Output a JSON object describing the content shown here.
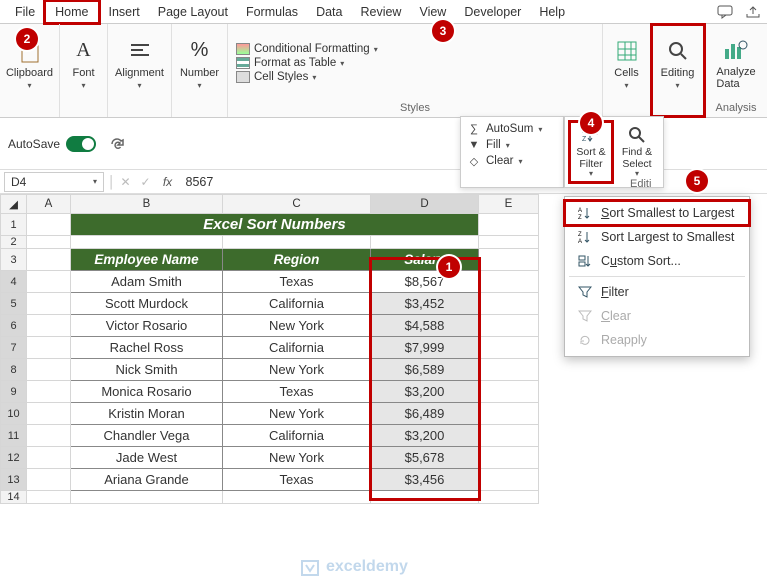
{
  "tabs": {
    "file": "File",
    "home": "Home",
    "insert": "Insert",
    "pagelayout": "Page Layout",
    "formulas": "Formulas",
    "data": "Data",
    "review": "Review",
    "view": "View",
    "developer": "Developer",
    "help": "Help"
  },
  "ribbon": {
    "clipboard": "Clipboard",
    "font": "Font",
    "alignment": "Alignment",
    "number": "Number",
    "styles_label": "Styles",
    "cond_fmt": "Conditional Formatting",
    "fmt_table": "Format as Table",
    "cell_styles": "Cell Styles",
    "cells": "Cells",
    "editing": "Editing",
    "analysis": "Analysis",
    "analyze_data": "Analyze\nData"
  },
  "substrip": {
    "autosave": "AutoSave",
    "autosum": "AutoSum",
    "fill": "Fill",
    "clear": "Clear",
    "sort_filter": "Sort &\nFilter",
    "find_select": "Find &\nSelect",
    "editing_label": "Editi"
  },
  "fbar": {
    "namebox": "D4",
    "formula": "8567"
  },
  "cols": {
    "a": "A",
    "b": "B",
    "c": "C",
    "d": "D",
    "e": "E"
  },
  "rows": [
    "1",
    "2",
    "3",
    "4",
    "5",
    "6",
    "7",
    "8",
    "9",
    "10",
    "11",
    "12",
    "13",
    "14"
  ],
  "title": "Excel Sort Numbers",
  "headers": {
    "emp": "Employee Name",
    "region": "Region",
    "salary": "Salary"
  },
  "data": [
    {
      "emp": "Adam Smith",
      "region": "Texas",
      "salary": "$8,567"
    },
    {
      "emp": "Scott Murdock",
      "region": "California",
      "salary": "$3,452"
    },
    {
      "emp": "Victor Rosario",
      "region": "New York",
      "salary": "$4,588"
    },
    {
      "emp": "Rachel Ross",
      "region": "California",
      "salary": "$7,999"
    },
    {
      "emp": "Nick Smith",
      "region": "New York",
      "salary": "$6,589"
    },
    {
      "emp": "Monica Rosario",
      "region": "Texas",
      "salary": "$3,200"
    },
    {
      "emp": "Kristin Moran",
      "region": "New York",
      "salary": "$6,489"
    },
    {
      "emp": "Chandler Vega",
      "region": "California",
      "salary": "$3,200"
    },
    {
      "emp": "Jade West",
      "region": "New York",
      "salary": "$5,678"
    },
    {
      "emp": "Ariana Grande",
      "region": "Texas",
      "salary": "$3,456"
    }
  ],
  "menu": {
    "s2l": "Sort Smallest to Largest",
    "l2s": "Sort Largest to Smallest",
    "custom": "Custom Sort...",
    "filter": "Filter",
    "clear": "Clear",
    "reapply": "Reapply"
  },
  "badges": {
    "b1": "1",
    "b2": "2",
    "b3": "3",
    "b4": "4",
    "b5": "5"
  },
  "watermark": "exceldemy"
}
